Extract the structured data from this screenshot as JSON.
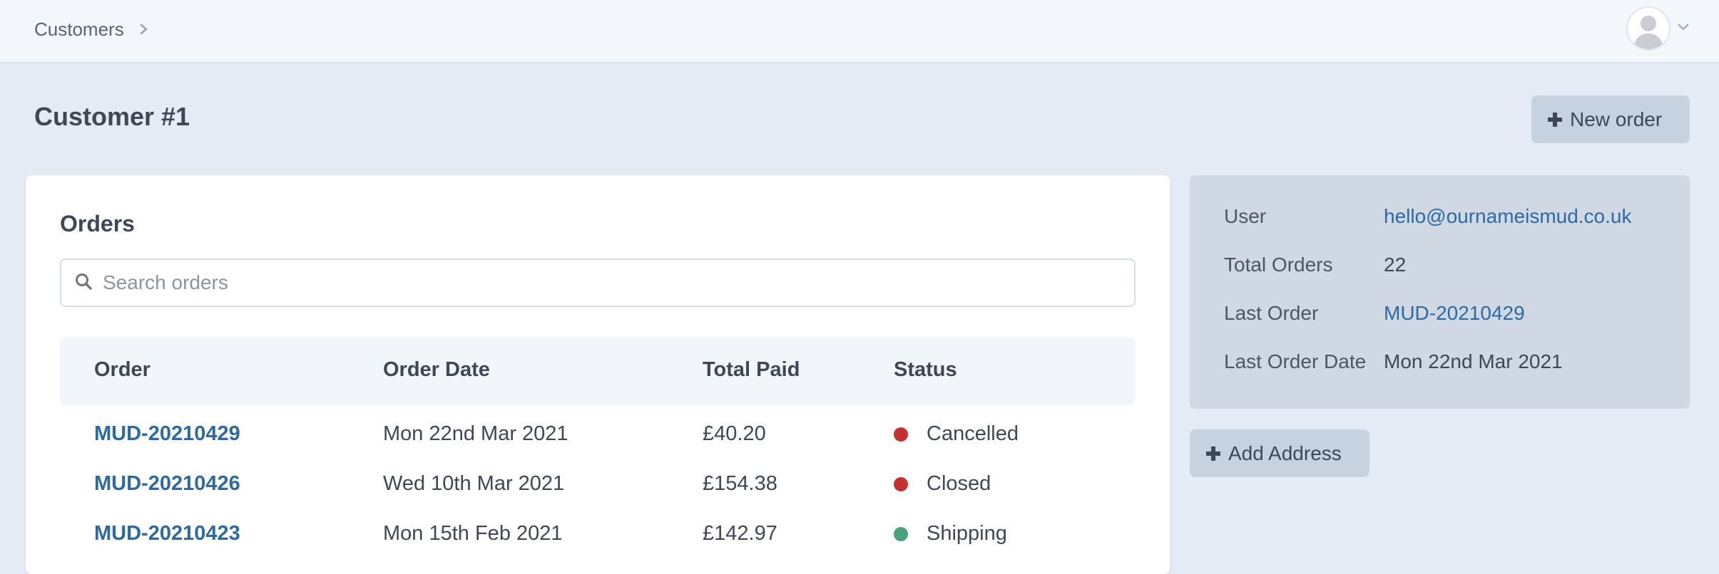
{
  "breadcrumb": {
    "items": [
      "Customers"
    ]
  },
  "page": {
    "title": "Customer #1"
  },
  "actions": {
    "new_order": "New order",
    "add_address": "Add Address"
  },
  "orders": {
    "heading": "Orders",
    "search_placeholder": "Search orders",
    "columns": [
      "Order",
      "Order Date",
      "Total Paid",
      "Status"
    ],
    "rows": [
      {
        "order": "MUD-20210429",
        "date": "Mon 22nd Mar 2021",
        "total": "£40.20",
        "status": "Cancelled",
        "status_color": "#c53030"
      },
      {
        "order": "MUD-20210426",
        "date": "Wed 10th Mar 2021",
        "total": "£154.38",
        "status": "Closed",
        "status_color": "#c53030"
      },
      {
        "order": "MUD-20210423",
        "date": "Mon 15th Feb 2021",
        "total": "£142.97",
        "status": "Shipping",
        "status_color": "#48a27a"
      }
    ]
  },
  "customer_info": {
    "user_label": "User",
    "user_value": "hello@ournameismud.co.uk",
    "total_orders_label": "Total Orders",
    "total_orders_value": "22",
    "last_order_label": "Last Order",
    "last_order_value": "MUD-20210429",
    "last_order_date_label": "Last Order Date",
    "last_order_date_value": "Mon 22nd Mar 2021"
  },
  "icons": {
    "breadcrumb_separator": "chevron-right-icon",
    "avatar": "user-avatar-icon",
    "menu": "chevron-down-icon",
    "search": "search-icon",
    "add": "plus-icon"
  },
  "colors": {
    "accent": "#2b6aa3",
    "background": "#e4ebf4",
    "button": "#c6d2df"
  }
}
